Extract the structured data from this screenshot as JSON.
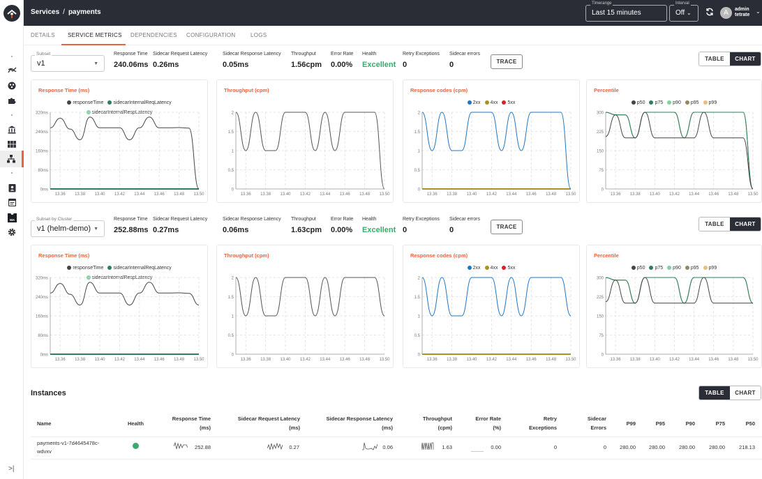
{
  "topbar": {
    "breadcrumb": [
      "Services",
      "payments"
    ],
    "breadcrumb_sep": "/",
    "timerange_label": "Timerange",
    "timerange_value": "Last 15 minutes",
    "interval_label": "Interval",
    "interval_value": "Off",
    "user_name": "admin",
    "user_org": "tetrate",
    "avatar_initial": "A"
  },
  "tabs": [
    {
      "label": "DETAILS",
      "active": false
    },
    {
      "label": "SERVICE METRICS",
      "active": true
    },
    {
      "label": "DEPENDENCIES",
      "active": false
    },
    {
      "label": "CONFIGURATION",
      "active": false
    },
    {
      "label": "LOGS",
      "active": false
    }
  ],
  "sidebar": {
    "icons": [
      "topology-icon",
      "services-icon",
      "extensions-icon",
      "institution-icon",
      "grid-icon",
      "hierarchy-icon",
      "user-badge-icon",
      "calendar-icon",
      "wasm-icon",
      "settings-icon"
    ],
    "active": "hierarchy-icon",
    "collapse_glyph": ">|"
  },
  "sections": [
    {
      "select_label": "Subset",
      "select_value": "v1",
      "metrics": [
        {
          "label": "Response Time",
          "value": "240.06ms"
        },
        {
          "label": "Sidecar Request Latency",
          "value": "0.26ms"
        },
        {
          "label": "Sidecar Response Latency",
          "value": "0.05ms"
        },
        {
          "label": "Throughput",
          "value": "1.56cpm"
        },
        {
          "label": "Error Rate",
          "value": "0.00%"
        },
        {
          "label": "Health",
          "value": "Excellent"
        },
        {
          "label": "Retry Exceptions",
          "value": "0"
        },
        {
          "label": "Sidecar errors",
          "value": "0"
        }
      ],
      "trace_label": "TRACE",
      "toggle": {
        "table": "TABLE",
        "chart": "CHART",
        "selected": "chart"
      }
    },
    {
      "select_label": "Subset by Cluster",
      "select_value": "v1 (helm-demo)",
      "metrics": [
        {
          "label": "Response Time",
          "value": "252.88ms"
        },
        {
          "label": "Sidecar Request Latency",
          "value": "0.27ms"
        },
        {
          "label": "Sidecar Response Latency",
          "value": "0.06ms"
        },
        {
          "label": "Throughput",
          "value": "1.63cpm"
        },
        {
          "label": "Error Rate",
          "value": "0.00%"
        },
        {
          "label": "Health",
          "value": "Excellent"
        },
        {
          "label": "Retry Exceptions",
          "value": "0"
        },
        {
          "label": "Sidecar errors",
          "value": "0"
        }
      ],
      "trace_label": "TRACE",
      "toggle": {
        "table": "TABLE",
        "chart": "CHART",
        "selected": "chart"
      }
    }
  ],
  "chart_data": [
    {
      "type": "line",
      "title": "Response Time (ms)",
      "section": 0,
      "x": [
        "13.35",
        "13.36",
        "13.37",
        "13.38",
        "13.39",
        "13.40",
        "13.41",
        "13.42",
        "13.43",
        "13.44",
        "13.45",
        "13.46",
        "13.47",
        "13.48",
        "13.49",
        "13.50"
      ],
      "xticks": [
        "13.36",
        "13.38",
        "13.40",
        "13.42",
        "13.44",
        "13.46",
        "13.48",
        "13.50"
      ],
      "yticks": [
        "0ms",
        "80ms",
        "160ms",
        "240ms",
        "320ms"
      ],
      "ylim": [
        0,
        320
      ],
      "series": [
        {
          "name": "responseTime",
          "color": "#444444",
          "values": [
            255,
            295,
            250,
            205,
            300,
            255,
            255,
            255,
            205,
            255,
            300,
            255,
            255,
            256,
            254,
            0
          ]
        },
        {
          "name": "sidecarInternalReqLatency",
          "color": "#2e7d5b",
          "values": [
            0,
            0,
            0,
            0,
            0,
            0,
            0,
            0,
            0,
            0,
            0,
            0,
            0,
            0,
            0,
            0
          ]
        },
        {
          "name": "sidecarInternalRespLatency",
          "color": "#7fd3a0",
          "values": [
            0,
            0,
            0,
            0,
            0,
            0,
            0,
            0,
            0,
            0,
            0,
            0,
            0,
            0,
            0,
            0
          ]
        }
      ]
    },
    {
      "type": "line",
      "title": "Throughput (cpm)",
      "section": 0,
      "legend": false,
      "x": [
        "13.35",
        "13.36",
        "13.37",
        "13.38",
        "13.39",
        "13.40",
        "13.41",
        "13.42",
        "13.43",
        "13.44",
        "13.45",
        "13.46",
        "13.47",
        "13.48",
        "13.49",
        "13.50"
      ],
      "xticks": [
        "13.36",
        "13.38",
        "13.40",
        "13.42",
        "13.44",
        "13.46",
        "13.48",
        "13.50"
      ],
      "yticks": [
        "0",
        "0.5",
        "1",
        "1.5",
        "2"
      ],
      "ylim": [
        0,
        2
      ],
      "series": [
        {
          "name": "throughput",
          "color": "#555555",
          "values": [
            2,
            1,
            2,
            1,
            1,
            2,
            2,
            2,
            1,
            2,
            1,
            2,
            2,
            2,
            2,
            0
          ]
        }
      ]
    },
    {
      "type": "line",
      "title": "Response codes (cpm)",
      "section": 0,
      "x": [
        "13.35",
        "13.36",
        "13.37",
        "13.38",
        "13.39",
        "13.40",
        "13.41",
        "13.42",
        "13.43",
        "13.44",
        "13.45",
        "13.46",
        "13.47",
        "13.48",
        "13.49",
        "13.50"
      ],
      "xticks": [
        "13.36",
        "13.38",
        "13.40",
        "13.42",
        "13.44",
        "13.46",
        "13.48",
        "13.50"
      ],
      "yticks": [
        "0",
        "0.5",
        "1",
        "1.5",
        "2"
      ],
      "ylim": [
        0,
        2
      ],
      "series": [
        {
          "name": "2xx",
          "color": "#1f77c4",
          "values": [
            2,
            1,
            2,
            1,
            1,
            2,
            2,
            2,
            1,
            2,
            1,
            2,
            2,
            2,
            2,
            0
          ]
        },
        {
          "name": "4xx",
          "color": "#a89222",
          "values": [
            0,
            0,
            0,
            0,
            0,
            0,
            0,
            0,
            0,
            0,
            0,
            0,
            0,
            0,
            0,
            0
          ]
        },
        {
          "name": "5xx",
          "color": "#d9202b",
          "values": [
            0,
            0,
            0,
            0,
            0,
            0,
            0,
            0,
            0,
            0,
            0,
            0,
            0,
            0,
            0,
            0
          ]
        }
      ]
    },
    {
      "type": "line",
      "title": "Percentile",
      "section": 0,
      "x": [
        "13.35",
        "13.36",
        "13.37",
        "13.38",
        "13.39",
        "13.40",
        "13.41",
        "13.42",
        "13.43",
        "13.44",
        "13.45",
        "13.46",
        "13.47",
        "13.48",
        "13.49",
        "13.50"
      ],
      "xticks": [
        "13.36",
        "13.38",
        "13.40",
        "13.42",
        "13.44",
        "13.46",
        "13.48",
        "13.50"
      ],
      "yticks": [
        "0",
        "75",
        "150",
        "225",
        "300"
      ],
      "ylim": [
        0,
        300
      ],
      "series": [
        {
          "name": "p50",
          "color": "#444444",
          "values": [
            205,
            290,
            200,
            200,
            300,
            200,
            200,
            200,
            200,
            200,
            300,
            200,
            200,
            200,
            200,
            0
          ]
        },
        {
          "name": "p75",
          "color": "#2e7d5b",
          "values": [
            300,
            290,
            290,
            200,
            300,
            300,
            300,
            300,
            200,
            300,
            300,
            300,
            300,
            300,
            300,
            0
          ]
        },
        {
          "name": "p90",
          "color": "#7fd3a0",
          "values": [
            300,
            290,
            290,
            200,
            300,
            300,
            300,
            300,
            200,
            300,
            300,
            300,
            300,
            300,
            300,
            0
          ]
        },
        {
          "name": "p95",
          "color": "#8f8a62",
          "values": [
            300,
            290,
            290,
            200,
            300,
            300,
            300,
            300,
            200,
            300,
            300,
            300,
            300,
            300,
            300,
            0
          ]
        },
        {
          "name": "p99",
          "color": "#e6bf7c",
          "values": [
            300,
            290,
            290,
            200,
            300,
            300,
            300,
            300,
            200,
            300,
            300,
            300,
            300,
            300,
            300,
            0
          ]
        }
      ]
    },
    {
      "type": "line",
      "title": "Response Time (ms)",
      "section": 1,
      "x": [
        "13.35",
        "13.36",
        "13.37",
        "13.38",
        "13.39",
        "13.40",
        "13.41",
        "13.42",
        "13.43",
        "13.44",
        "13.45",
        "13.46",
        "13.47",
        "13.48",
        "13.49",
        "13.50"
      ],
      "xticks": [
        "13.36",
        "13.38",
        "13.40",
        "13.42",
        "13.44",
        "13.46",
        "13.48",
        "13.50"
      ],
      "yticks": [
        "0ms",
        "80ms",
        "160ms",
        "240ms",
        "320ms"
      ],
      "ylim": [
        0,
        320
      ],
      "series": [
        {
          "name": "responseTime",
          "color": "#444444",
          "values": [
            255,
            295,
            250,
            205,
            300,
            255,
            255,
            255,
            205,
            255,
            300,
            255,
            255,
            256,
            254,
            205
          ]
        },
        {
          "name": "sidecarInternalReqLatency",
          "color": "#2e7d5b",
          "values": [
            0,
            0,
            0,
            0,
            0,
            0,
            0,
            0,
            0,
            0,
            0,
            0,
            0,
            0,
            0,
            0
          ]
        },
        {
          "name": "sidecarInternalRespLatency",
          "color": "#7fd3a0",
          "values": [
            0,
            0,
            0,
            0,
            0,
            0,
            0,
            0,
            0,
            0,
            0,
            0,
            0,
            0,
            0,
            0
          ]
        }
      ]
    },
    {
      "type": "line",
      "title": "Throughput (cpm)",
      "section": 1,
      "legend": false,
      "x": [
        "13.35",
        "13.36",
        "13.37",
        "13.38",
        "13.39",
        "13.40",
        "13.41",
        "13.42",
        "13.43",
        "13.44",
        "13.45",
        "13.46",
        "13.47",
        "13.48",
        "13.49",
        "13.50"
      ],
      "xticks": [
        "13.36",
        "13.38",
        "13.40",
        "13.42",
        "13.44",
        "13.46",
        "13.48",
        "13.50"
      ],
      "yticks": [
        "0",
        "0.5",
        "1",
        "1.5",
        "2"
      ],
      "ylim": [
        0,
        2
      ],
      "series": [
        {
          "name": "throughput",
          "color": "#555555",
          "values": [
            2,
            1,
            2,
            1,
            1,
            2,
            2,
            2,
            1,
            2,
            1,
            2,
            2,
            2,
            2,
            1
          ]
        }
      ]
    },
    {
      "type": "line",
      "title": "Response codes (cpm)",
      "section": 1,
      "x": [
        "13.35",
        "13.36",
        "13.37",
        "13.38",
        "13.39",
        "13.40",
        "13.41",
        "13.42",
        "13.43",
        "13.44",
        "13.45",
        "13.46",
        "13.47",
        "13.48",
        "13.49",
        "13.50"
      ],
      "xticks": [
        "13.36",
        "13.38",
        "13.40",
        "13.42",
        "13.44",
        "13.46",
        "13.48",
        "13.50"
      ],
      "yticks": [
        "0",
        "0.5",
        "1",
        "1.5",
        "2"
      ],
      "ylim": [
        0,
        2
      ],
      "series": [
        {
          "name": "2xx",
          "color": "#1f77c4",
          "values": [
            2,
            1,
            2,
            1,
            1,
            2,
            2,
            2,
            1,
            2,
            1,
            2,
            2,
            2,
            2,
            1
          ]
        },
        {
          "name": "4xx",
          "color": "#a89222",
          "values": [
            0,
            0,
            0,
            0,
            0,
            0,
            0,
            0,
            0,
            0,
            0,
            0,
            0,
            0,
            0,
            0
          ]
        },
        {
          "name": "5xx",
          "color": "#d9202b",
          "values": [
            0,
            0,
            0,
            0,
            0,
            0,
            0,
            0,
            0,
            0,
            0,
            0,
            0,
            0,
            0,
            0
          ]
        }
      ]
    },
    {
      "type": "line",
      "title": "Percentile",
      "section": 1,
      "x": [
        "13.35",
        "13.36",
        "13.37",
        "13.38",
        "13.39",
        "13.40",
        "13.41",
        "13.42",
        "13.43",
        "13.44",
        "13.45",
        "13.46",
        "13.47",
        "13.48",
        "13.49",
        "13.50"
      ],
      "xticks": [
        "13.36",
        "13.38",
        "13.40",
        "13.42",
        "13.44",
        "13.46",
        "13.48",
        "13.50"
      ],
      "yticks": [
        "0",
        "75",
        "150",
        "225",
        "300"
      ],
      "ylim": [
        0,
        300
      ],
      "series": [
        {
          "name": "p50",
          "color": "#444444",
          "values": [
            205,
            290,
            200,
            200,
            300,
            200,
            200,
            200,
            200,
            200,
            300,
            200,
            200,
            200,
            200,
            200
          ]
        },
        {
          "name": "p75",
          "color": "#2e7d5b",
          "values": [
            300,
            290,
            290,
            200,
            300,
            300,
            300,
            300,
            200,
            300,
            300,
            300,
            300,
            300,
            300,
            200
          ]
        },
        {
          "name": "p90",
          "color": "#7fd3a0",
          "values": [
            300,
            290,
            290,
            200,
            300,
            300,
            300,
            300,
            200,
            300,
            300,
            300,
            300,
            300,
            300,
            200
          ]
        },
        {
          "name": "p95",
          "color": "#8f8a62",
          "values": [
            300,
            290,
            290,
            200,
            300,
            300,
            300,
            300,
            200,
            300,
            300,
            300,
            300,
            300,
            300,
            200
          ]
        },
        {
          "name": "p99",
          "color": "#e6bf7c",
          "values": [
            300,
            290,
            290,
            200,
            300,
            300,
            300,
            300,
            200,
            300,
            300,
            300,
            300,
            300,
            300,
            200
          ]
        }
      ]
    }
  ],
  "instances": {
    "title": "Instances",
    "toggle": {
      "table": "TABLE",
      "chart": "CHART",
      "selected": "table"
    },
    "columns": [
      {
        "label": "Name"
      },
      {
        "label": "Health"
      },
      {
        "label": "Response Time",
        "unit": "(ms)"
      },
      {
        "label": "Sidecar Request Latency",
        "unit": "(ms)"
      },
      {
        "label": "Sidecar Response Latency",
        "unit": "(ms)"
      },
      {
        "label": "Throughput",
        "unit": "(cpm)"
      },
      {
        "label": "Error Rate",
        "unit": "(%)"
      },
      {
        "label": "Retry",
        "unit": "Exceptions"
      },
      {
        "label": "Sidecar",
        "unit": "Errors"
      },
      {
        "label": "P99"
      },
      {
        "label": "P95"
      },
      {
        "label": "P90"
      },
      {
        "label": "P75"
      },
      {
        "label": "P50"
      }
    ],
    "rows": [
      {
        "name_line1": "payments-v1-7d4645478c-",
        "name_line2": "wdvxv",
        "health": "healthy",
        "response_time": "252.88",
        "sidecar_req": "0.27",
        "sidecar_resp": "0.06",
        "throughput": "1.63",
        "error_rate": "0.00",
        "retry_exceptions": "0",
        "sidecar_errors": "0",
        "p99": "280.00",
        "p95": "280.00",
        "p90": "280.00",
        "p75": "280.00",
        "p50": "218.13"
      }
    ]
  },
  "colors": {
    "accent": "#e8623e",
    "topbar": "#2a2d36",
    "health_good": "#3aaa6e"
  }
}
